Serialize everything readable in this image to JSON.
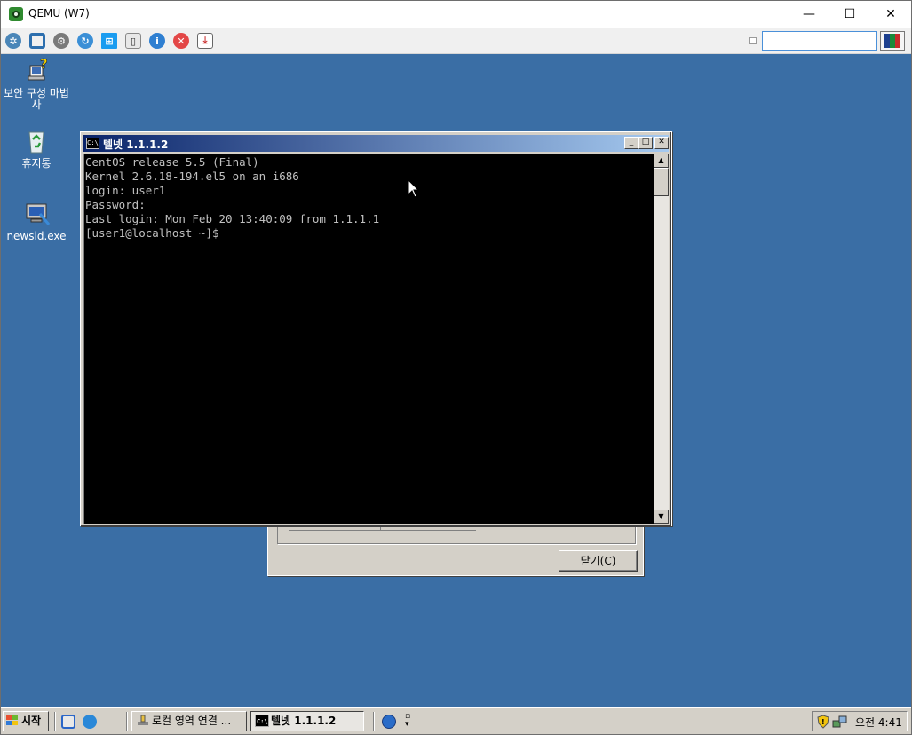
{
  "host": {
    "title": "QEMU (W7)",
    "window_controls": {
      "minimize": "—",
      "maximize": "☐",
      "close": "✕"
    },
    "toolbar_icons": [
      "network-icon",
      "fullscreen-icon",
      "settings-icon",
      "refresh-icon",
      "windows-icon",
      "disk-icon",
      "info-icon",
      "stop-icon",
      "download-icon"
    ]
  },
  "desktop": {
    "background": "#3a6ea5",
    "icons": [
      {
        "label": "보안 구성 마법사",
        "icon": "security-wizard-icon"
      },
      {
        "label": "휴지통",
        "icon": "recycle-bin-icon"
      },
      {
        "label": "newsid.exe",
        "icon": "computer-icon"
      }
    ]
  },
  "telnet": {
    "title": "텔넷 1.1.1.2",
    "icon_text": "C:\\",
    "lines": [
      "CentOS release 5.5 (Final)",
      "Kernel 2.6.18-194.el5 on an i686",
      "login: user1",
      "Password:",
      "Last login: Mon Feb 20 13:40:09 from 1.1.1.1",
      "[user1@localhost ~]$"
    ]
  },
  "background_dialog": {
    "close_button": "닫기(C)"
  },
  "taskbar": {
    "start_label": "시작",
    "tasks": [
      {
        "label": "로컬 영역 연결 ...",
        "active": false
      },
      {
        "label": "텔넷 1.1.1.2",
        "active": true
      }
    ],
    "clock": "오전 4:41"
  }
}
